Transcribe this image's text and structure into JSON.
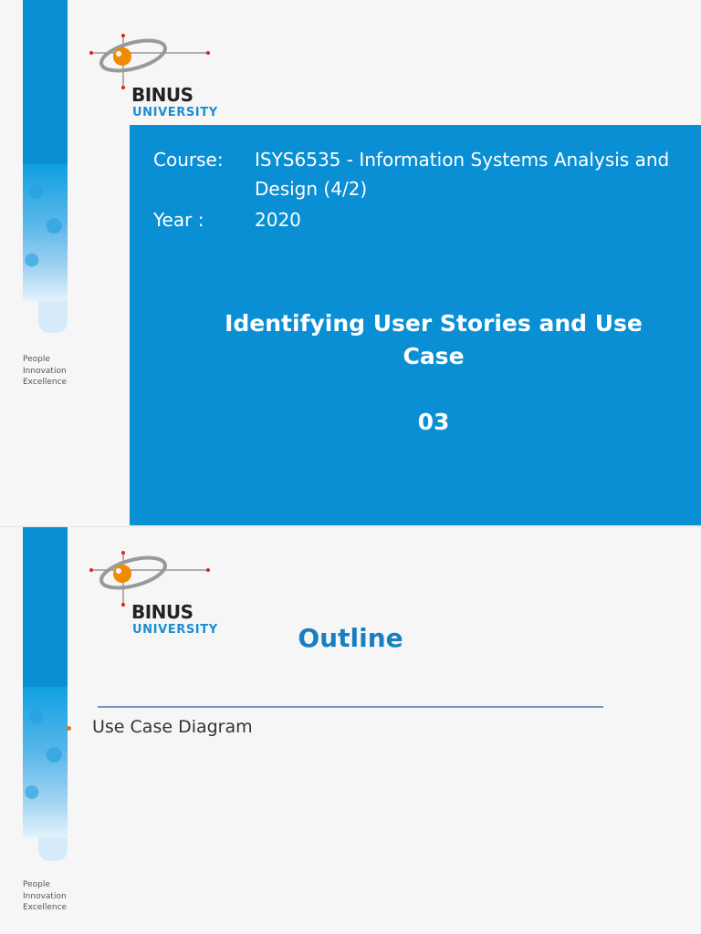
{
  "slide1": {
    "logo": {
      "name": "BINUS",
      "sub": "UNIVERSITY"
    },
    "tagline": [
      "People",
      "Innovation",
      "Excellence"
    ],
    "course_label": "Course:",
    "course_value_line1": "ISYS6535  - Information Systems Analysis and",
    "course_value_line2": "Design (4/2)",
    "year_label": "Year :",
    "year_value": "2020",
    "title_line1": "Identifying User Stories and Use",
    "title_line2": "Case",
    "session": "03"
  },
  "slide2": {
    "logo": {
      "name": "BINUS",
      "sub": "UNIVERSITY"
    },
    "tagline": [
      "People",
      "Innovation",
      "Excellence"
    ],
    "title": "Outline",
    "bullets": [
      "Use Case Diagram"
    ]
  },
  "colors": {
    "brand_blue": "#0a8fd4",
    "title_blue": "#1a7fc1",
    "bullet_orange": "#e8731a"
  }
}
